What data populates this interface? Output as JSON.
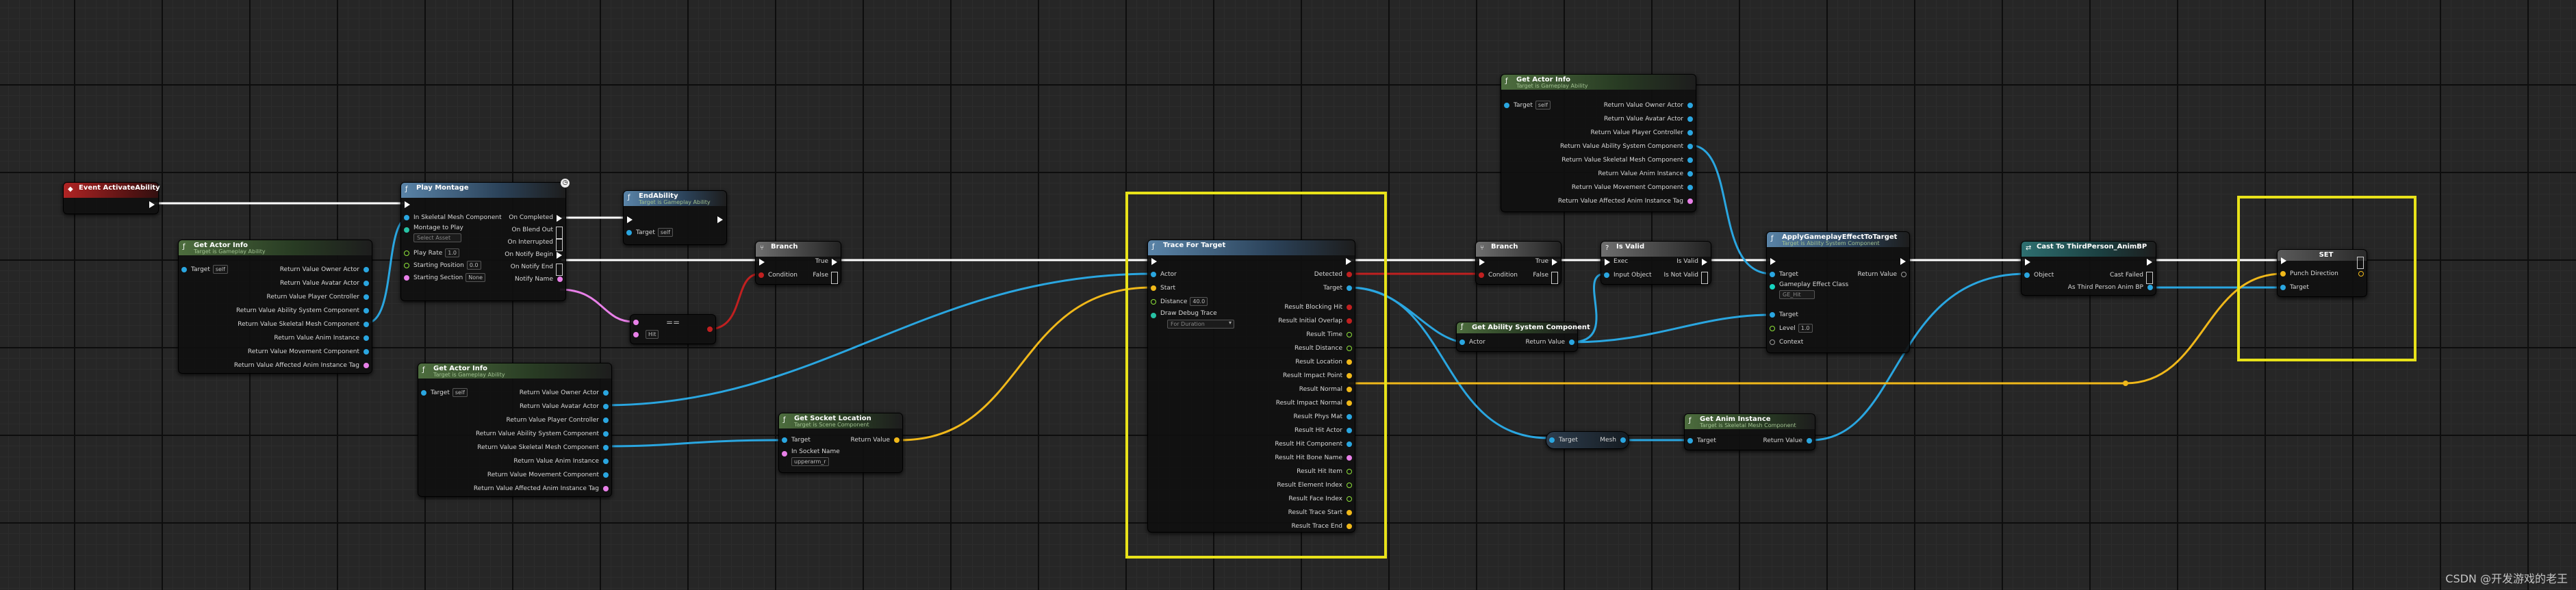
{
  "colors": {
    "exec": "#ffffff",
    "object": "#2aa6e0",
    "struct": "#f0b81a",
    "bool": "#c02020",
    "float": "#8fe43a",
    "name": "#e880e8",
    "class": "#17d4c0",
    "selection": "#e8e21a"
  },
  "event": {
    "title": "Event ActivateAbility"
  },
  "play_montage": {
    "title": "Play Montage",
    "in_mesh": "In Skeletal Mesh Component",
    "montage_label": "Montage to Play",
    "montage_value": "Select Asset",
    "play_rate_label": "Play Rate",
    "play_rate_value": "1.0",
    "start_pos_label": "Starting Position",
    "start_pos_value": "0.0",
    "start_section_label": "Starting Section",
    "start_section_value": "None",
    "on_completed": "On Completed",
    "on_blend_out": "On Blend Out",
    "on_interrupted": "On Interrupted",
    "on_notify_begin": "On Notify Begin",
    "on_notify_end": "On Notify End",
    "notify_name": "Notify Name"
  },
  "end_ability": {
    "title": "EndAbility",
    "subtitle": "Target is Gameplay Ability",
    "target": "Target",
    "target_value": "self"
  },
  "get_actor_info_1": {
    "title": "Get Actor Info",
    "subtitle": "Target is Gameplay Ability",
    "target": "Target",
    "target_value": "self",
    "outputs": [
      "Return Value Owner Actor",
      "Return Value Avatar Actor",
      "Return Value Player Controller",
      "Return Value Ability System Component",
      "Return Value Skeletal Mesh Component",
      "Return Value Anim Instance",
      "Return Value Movement Component",
      "Return Value Affected Anim Instance Tag"
    ]
  },
  "get_actor_info_2": {
    "title": "Get Actor Info",
    "subtitle": "Target is Gameplay Ability",
    "target": "Target",
    "target_value": "self",
    "outputs": [
      "Return Value Owner Actor",
      "Return Value Avatar Actor",
      "Return Value Player Controller",
      "Return Value Ability System Component",
      "Return Value Skeletal Mesh Component",
      "Return Value Anim Instance",
      "Return Value Movement Component",
      "Return Value Affected Anim Instance Tag"
    ]
  },
  "get_actor_info_3": {
    "title": "Get Actor Info",
    "subtitle": "Target is Gameplay Ability",
    "target": "Target",
    "target_value": "self",
    "outputs": [
      "Return Value Owner Actor",
      "Return Value Avatar Actor",
      "Return Value Player Controller",
      "Return Value Ability System Component",
      "Return Value Skeletal Mesh Component",
      "Return Value Anim Instance",
      "Return Value Movement Component",
      "Return Value Affected Anim Instance Tag"
    ]
  },
  "branch_1": {
    "title": "Branch",
    "condition": "Condition",
    "true_label": "True",
    "false_label": "False"
  },
  "branch_2": {
    "title": "Branch",
    "condition": "Condition",
    "true_label": "True",
    "false_label": "False"
  },
  "equal_node": {
    "label": "==",
    "value": "Hit"
  },
  "trace_for_target": {
    "title": "Trace For Target",
    "actor": "Actor",
    "start": "Start",
    "distance_label": "Distance",
    "distance_value": "40.0",
    "draw_debug_label": "Draw Debug Trace",
    "draw_debug_value": "For Duration",
    "detected": "Detected",
    "target": "Target",
    "outputs": [
      "Result Blocking Hit",
      "Result Initial Overlap",
      "Result Time",
      "Result Distance",
      "Result Location",
      "Result Impact Point",
      "Result Normal",
      "Result Impact Normal",
      "Result Phys Mat",
      "Result Hit Actor",
      "Result Hit Component",
      "Result Hit Bone Name",
      "Result Hit Item",
      "Result Element Index",
      "Result Face Index",
      "Result Trace Start",
      "Result Trace End"
    ]
  },
  "get_socket_location": {
    "title": "Get Socket Location",
    "subtitle": "Target is Scene Component",
    "target": "Target",
    "socket_name_label": "In Socket Name",
    "socket_name_value": "upperarm_r",
    "return_value": "Return Value"
  },
  "is_valid": {
    "title": "Is Valid",
    "exec": "Exec",
    "input_object": "Input Object",
    "is_valid": "Is Valid",
    "is_not_valid": "Is Not Valid"
  },
  "get_asc": {
    "title": "Get Ability System Component",
    "actor": "Actor",
    "return_value": "Return Value"
  },
  "apply_ge": {
    "title": "ApplyGameplayEffectToTarget",
    "subtitle": "Target is Ability System Component",
    "target": "Target",
    "ge_class_label": "Gameplay Effect Class",
    "ge_class_value": "GE_Hit",
    "target2": "Target",
    "level_label": "Level",
    "level_value": "1.0",
    "context": "Context",
    "return_value": "Return Value"
  },
  "get_mesh": {
    "target": "Target",
    "mesh": "Mesh"
  },
  "get_anim_instance": {
    "title": "Get Anim Instance",
    "subtitle": "Target is Skeletal Mesh Component",
    "target": "Target",
    "return_value": "Return Value"
  },
  "cast_node": {
    "title": "Cast To ThirdPerson_AnimBP",
    "object": "Object",
    "cast_failed": "Cast Failed",
    "as_label": "As Third Person Anim BP"
  },
  "set_node": {
    "title": "SET",
    "punch_direction": "Punch Direction",
    "target": "Target"
  },
  "watermark": "CSDN @开发游戏的老王"
}
